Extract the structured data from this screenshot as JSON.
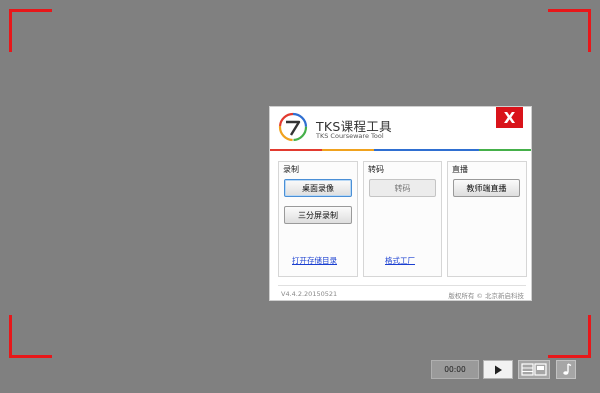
{
  "app": {
    "title": "TKS课程工具",
    "subtitle": "TKS Courseware Tool",
    "close_label": "X"
  },
  "colors": {
    "frame_marker": "#e8171a",
    "close_bg": "#d9131a",
    "stripe": [
      "#e23a2f",
      "#f0a21e",
      "#2f6fd1",
      "#2f6fd1",
      "#45b04a"
    ]
  },
  "sections": {
    "record": {
      "title": "录制",
      "desktop_record": "桌面录像",
      "triple_screen_record": "三分屏录制",
      "open_storage": "打开存储目录"
    },
    "transcode": {
      "title": "转码",
      "transcode_button": "转码",
      "format_factory": "格式工厂"
    },
    "live": {
      "title": "直播",
      "teacher_live": "教师端直播"
    }
  },
  "footer": {
    "version": "V4.4.2.20150521",
    "copyright": "版权所有 © 北京新启科技"
  },
  "player": {
    "time": "00:00",
    "icons": [
      "play-icon",
      "layout-icon",
      "music-icon"
    ]
  }
}
